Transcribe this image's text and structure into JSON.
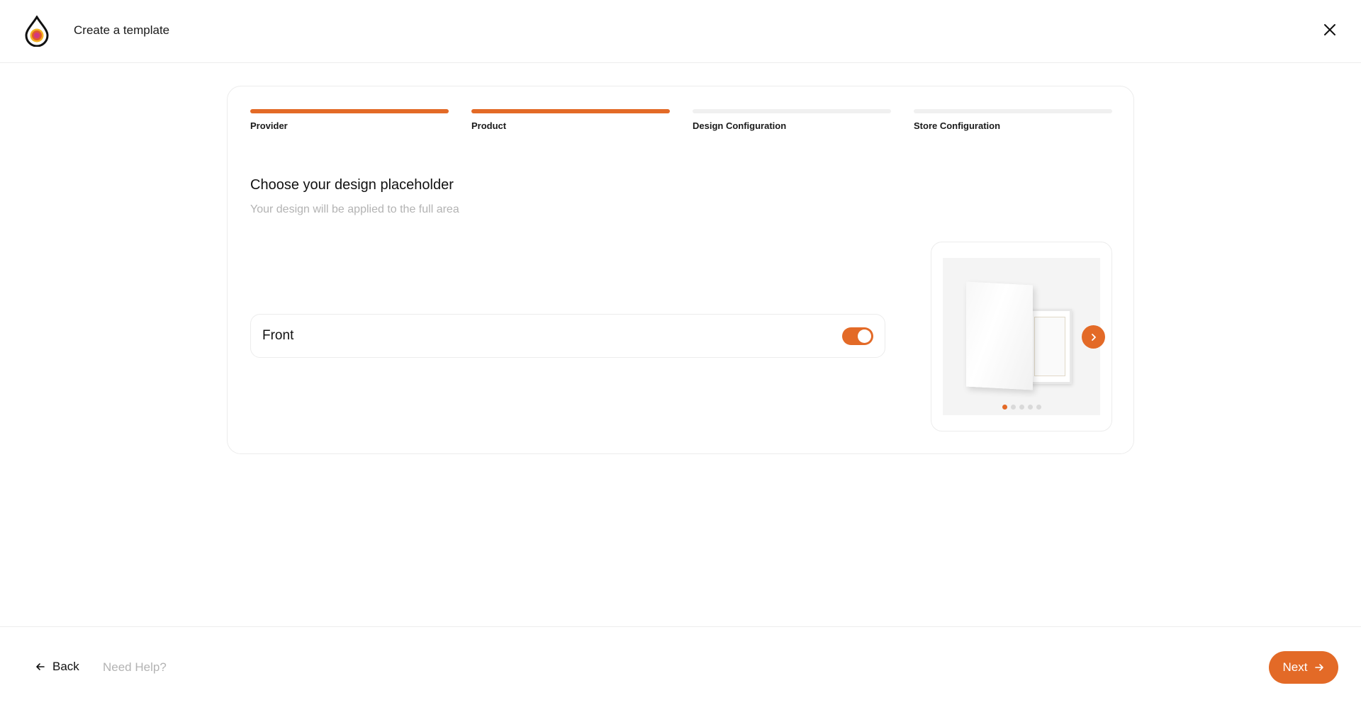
{
  "header": {
    "title": "Create a template",
    "logo_icon": "drop-logo-icon",
    "close_icon": "close-icon"
  },
  "colors": {
    "accent": "#e36a27",
    "border": "#ececec",
    "muted_text": "#b3b3b3"
  },
  "steps": [
    {
      "label": "Provider",
      "completed": true
    },
    {
      "label": "Product",
      "completed": true
    },
    {
      "label": "Design Configuration",
      "completed": false
    },
    {
      "label": "Store Configuration",
      "completed": false
    }
  ],
  "main": {
    "title": "Choose your design placeholder",
    "subtitle": "Your design will be applied to the full area",
    "options": [
      {
        "label": "Front",
        "enabled": true
      }
    ]
  },
  "preview": {
    "image_icon": "canvas-print-image",
    "slide_count": 5,
    "active_slide": 1,
    "next_icon": "chevron-right-icon"
  },
  "footer": {
    "back_label": "Back",
    "back_icon": "arrow-left-icon",
    "help_label": "Need Help?",
    "next_label": "Next",
    "next_icon": "arrow-right-icon"
  }
}
